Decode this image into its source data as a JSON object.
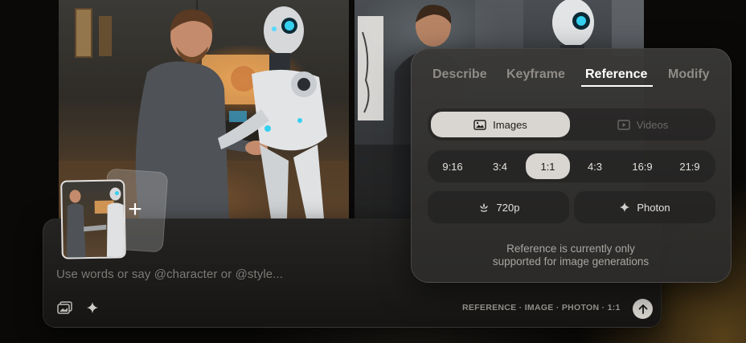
{
  "prompt": {
    "placeholder": "Use words or say @character or @style...",
    "status": "REFERENCE · IMAGE · PHOTON · 1:1",
    "icons": [
      "image-stack-icon",
      "sparkle-icon",
      "arrow-up-icon"
    ]
  },
  "thumbnail": {
    "add_icon": "+"
  },
  "panel": {
    "tabs": [
      {
        "label": "Describe"
      },
      {
        "label": "Keyframe"
      },
      {
        "label": "Reference"
      },
      {
        "label": "Modify"
      }
    ],
    "active_tab": "Reference",
    "media_types": [
      {
        "label": "Images",
        "icon": "image-icon"
      },
      {
        "label": "Videos",
        "icon": "video-icon"
      }
    ],
    "active_media": "Images",
    "aspect_ratios": [
      "9:16",
      "3:4",
      "1:1",
      "4:3",
      "16:9",
      "21:9"
    ],
    "active_aspect": "1:1",
    "resolution": {
      "label": "720p",
      "icon": "flower-icon"
    },
    "model": {
      "label": "Photon",
      "icon": "sparkle-icon"
    },
    "note_line1": "Reference is currently only",
    "note_line2": "supported for image generations"
  },
  "colors": {
    "panel_bg": "#3a3937",
    "active_pill": "#d9d6d1",
    "accent_text": "#ffffff",
    "muted_text": "#8f8c87"
  }
}
